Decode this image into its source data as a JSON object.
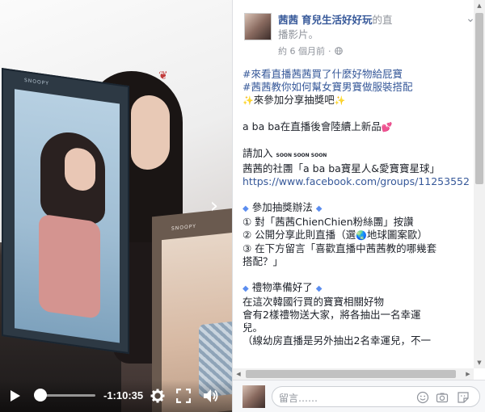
{
  "video": {
    "box_brand_left": "SNOOPY",
    "box_brand_right": "SNOOPY",
    "time": "-1:10:35",
    "progress": 0.05
  },
  "post": {
    "author": "茜茜",
    "page": "育兒生活好好玩",
    "author_suffix_1": "的直",
    "author_suffix_2": "播影片。",
    "timestamp": "約 6 個月前",
    "body": {
      "line1": "#來看直播茜茜買了什麼好物給屁寶",
      "line2": "#茜茜教你如何幫女寶男寶做服裝搭配",
      "line3": "來參加分享抽獎吧",
      "line4": "a ba ba在直播後會陸續上新品",
      "line5": "請加入",
      "line5_emoji": "SOON SOON SOON",
      "line6": "茜茜的社團「a ba ba寶星人&愛寶寶星球」",
      "line7": "https://www.facebook.com/groups/112535527",
      "line8": "參加抽獎辦法",
      "line9": "① 對「茜茜ChienChien粉絲團」按讚",
      "line10": "② 公開分享此則直播（選",
      "line10_b": "地球圖案歐）",
      "line11": "③ 在下方留言「喜歡直播中茜茜教的哪幾套",
      "line12": "搭配？」",
      "line13": "禮物準備好了",
      "line14": "在這次韓國行買的寶寶相關好物",
      "line15": "會有2樣禮物送大家，將各抽出一名幸運",
      "line16": "兒。",
      "line17": "（線幼房直播是另外抽出2名幸運兒，不一"
    }
  },
  "comment": {
    "placeholder": "留言……"
  },
  "colors": {
    "link": "#365899",
    "meta": "#90949c",
    "text": "#1d2129",
    "diamond": "#5b8def"
  },
  "icons": [
    "play-icon",
    "settings-icon",
    "fullscreen-icon",
    "volume-icon",
    "chevron-right-icon",
    "globe-icon",
    "options-icon",
    "emoji-icon",
    "camera-icon",
    "sticker-icon"
  ]
}
